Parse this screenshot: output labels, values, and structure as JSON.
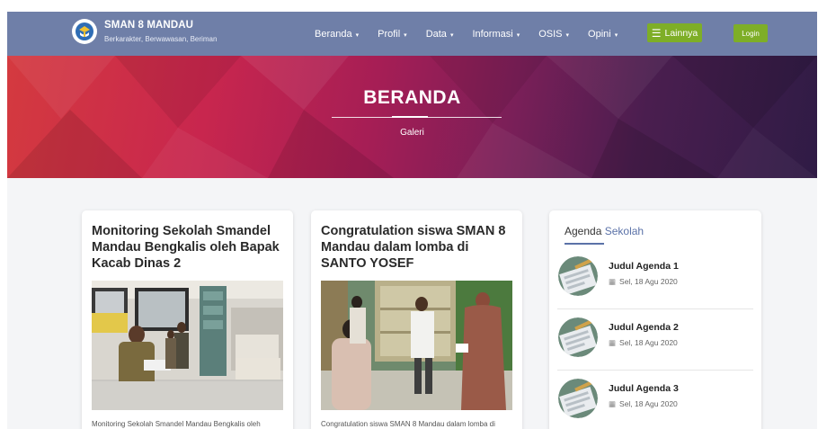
{
  "site": {
    "name": "SMAN 8 MANDAU",
    "tagline": "Berkarakter, Berwawasan, Beriman",
    "logo_icon": "school-crest-icon"
  },
  "nav": {
    "items": [
      {
        "label": "Beranda",
        "caret": "▾"
      },
      {
        "label": "Profil",
        "caret": "▾"
      },
      {
        "label": "Data",
        "caret": "▾"
      },
      {
        "label": "Informasi",
        "caret": "▾"
      },
      {
        "label": "OSIS",
        "caret": "▾"
      },
      {
        "label": "Opini",
        "caret": "▾"
      }
    ],
    "more_label": "Lainnya",
    "more_icon": "hamburger-icon",
    "login_label": "Login",
    "accent_color": "#7eae27",
    "bar_color": "#6f7fa8"
  },
  "hero": {
    "title": "BERANDA",
    "subtitle": "Galeri"
  },
  "news": [
    {
      "title": "Monitoring Sekolah Smandel Mandau Bengkalis oleh Bapak Kacab Dinas 2",
      "excerpt": "Monitoring Sekolah Smandel Mandau Bengkalis oleh"
    },
    {
      "title": "Congratulation siswa SMAN 8 Mandau dalam lomba di SANTO YOSEF",
      "excerpt": "Congratulation siswa SMAN 8 Mandau dalam lomba di"
    }
  ],
  "agenda": {
    "heading_plain": "Agenda",
    "heading_accent": "Sekolah",
    "items": [
      {
        "title": "Judul Agenda 1",
        "date": "Sel, 18 Agu 2020"
      },
      {
        "title": "Judul Agenda 2",
        "date": "Sel, 18 Agu 2020"
      },
      {
        "title": "Judul Agenda 3",
        "date": "Sel, 18 Agu 2020"
      }
    ],
    "date_icon": "calendar-icon"
  }
}
